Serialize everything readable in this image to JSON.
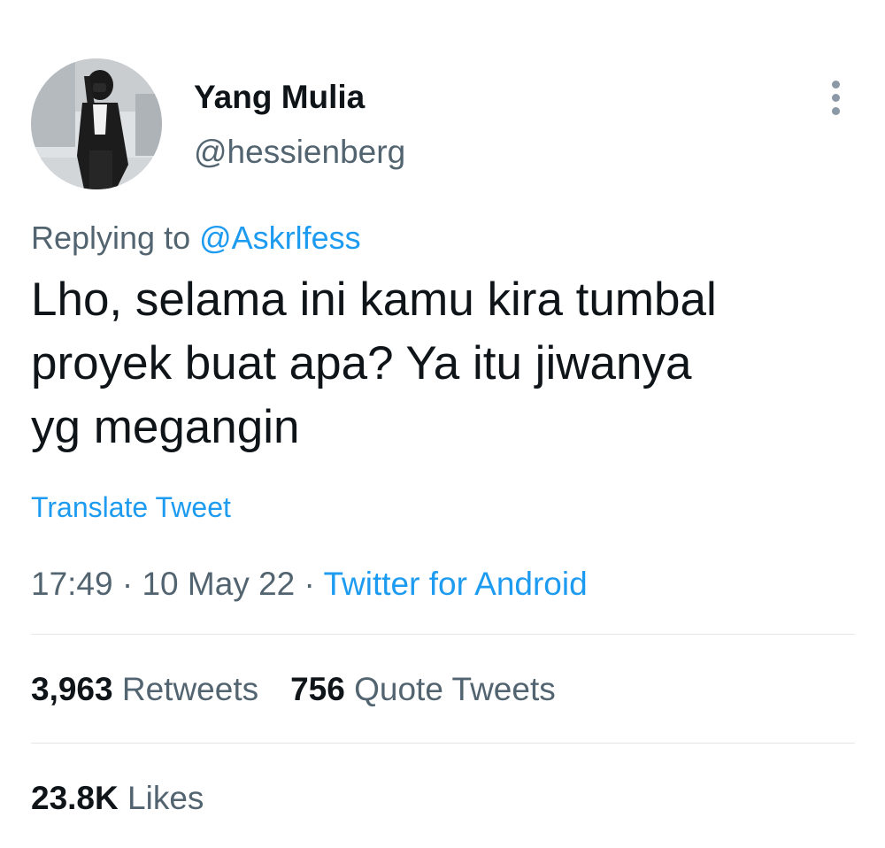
{
  "author": {
    "display_name": "Yang Mulia",
    "handle": "@hessienberg",
    "avatar_icon": "profile-photo"
  },
  "more_icon": "more-vertical-icon",
  "reply": {
    "prefix": "Replying to ",
    "to_handle": "@Askrlfess"
  },
  "tweet": {
    "lines": [
      "Lho, selama ini kamu kira tumbal",
      "proyek buat apa? Ya itu jiwanya",
      "yg megangin"
    ]
  },
  "translate_label": "Translate Tweet",
  "meta": {
    "time": "17:49",
    "separator": " · ",
    "date": "10 May 22",
    "source": "Twitter for Android"
  },
  "stats": {
    "retweets_count": "3,963",
    "retweets_label": "Retweets",
    "quotes_count": "756",
    "quotes_label": "Quote Tweets",
    "likes_count": "23.8K",
    "likes_label": "Likes"
  },
  "colors": {
    "accent": "#1d9bf0",
    "text": "#0f1419",
    "secondary": "#536471",
    "divider": "#e3e7ea"
  }
}
